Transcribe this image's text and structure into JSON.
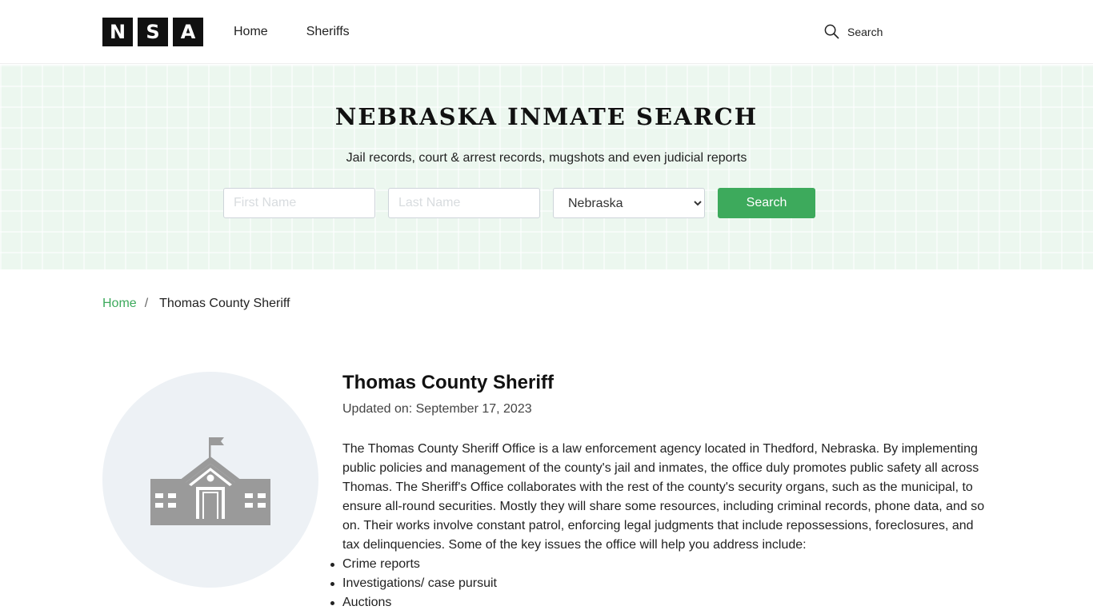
{
  "header": {
    "logo_letters": [
      "N",
      "S",
      "A"
    ],
    "nav": [
      {
        "label": "Home"
      },
      {
        "label": "Sheriffs"
      }
    ],
    "search_label": "Search"
  },
  "hero": {
    "title": "NEBRASKA INMATE SEARCH",
    "subtitle": "Jail records, court & arrest records, mugshots and even judicial reports",
    "first_name_placeholder": "First Name",
    "last_name_placeholder": "Last Name",
    "state_value": "Nebraska",
    "search_button": "Search"
  },
  "breadcrumb": {
    "home": "Home",
    "separator": "/",
    "current": "Thomas County Sheriff"
  },
  "main": {
    "title": "Thomas County Sheriff",
    "updated": "Updated on: September 17, 2023",
    "description": "The Thomas County Sheriff Office is a law enforcement agency located in Thedford, Nebraska. By implementing public policies and management of the county's jail and inmates, the office duly promotes public safety all across Thomas. The Sheriff's Office collaborates with the rest of the county's security organs, such as the municipal, to ensure all-round securities. Mostly they will share some resources, including criminal records, phone data, and so on. Their works involve constant patrol, enforcing legal judgments that include repossessions, foreclosures, and tax delinquencies. Some of the key issues the office will help you address include:",
    "list": [
      "Crime reports",
      "Investigations/ case pursuit",
      "Auctions"
    ]
  },
  "colors": {
    "accent": "#3daa5c",
    "hero_bg": "#ecf7ef",
    "avatar_bg": "#edf1f5",
    "icon_gray": "#9a9a9a"
  },
  "icons": {
    "search": "search-icon",
    "building": "courthouse-icon"
  }
}
